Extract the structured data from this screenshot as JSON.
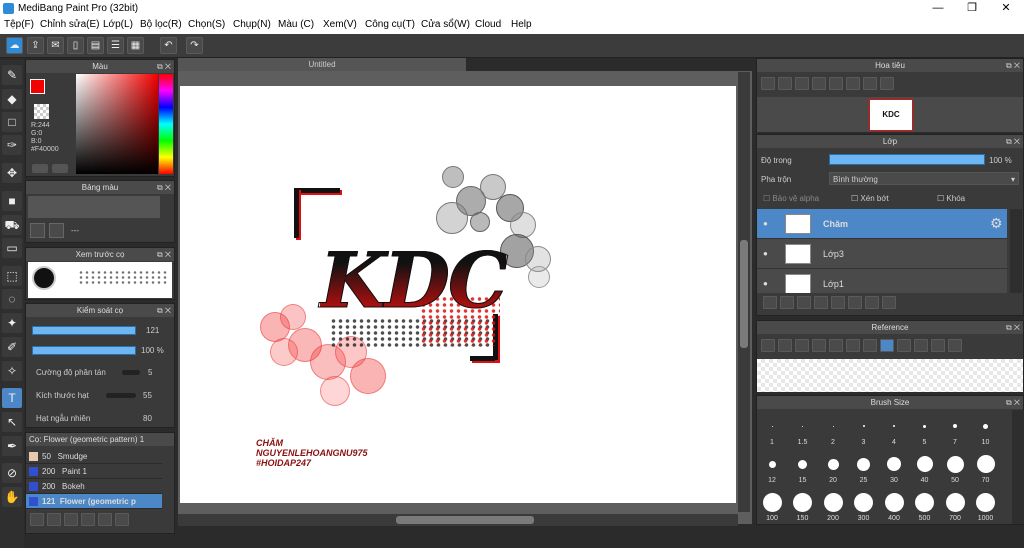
{
  "window": {
    "title": "MediBang Paint Pro (32bit)",
    "minimize": "—",
    "maximize": "❐",
    "close": "✕"
  },
  "menu": [
    "Tệp(F)",
    "Chỉnh sửa(E)",
    "Lớp(L)",
    "Bộ lọc(R)",
    "Chọn(S)",
    "Chụp(N)",
    "Màu (C)",
    "Xem(V)",
    "Công cụ(T)",
    "Cửa sổ(W)",
    "Cloud",
    "Help"
  ],
  "toolbar": {
    "undo": "↶",
    "redo": "↷"
  },
  "color_panel": {
    "title": "Màu",
    "readout": [
      "R:244",
      "G:0",
      "B:0",
      "#F40000"
    ],
    "primary": "#f40000"
  },
  "palette_panel": {
    "title": "Bảng màu",
    "footer": "---"
  },
  "brush_preview_panel": {
    "title": "Xem trước cọ"
  },
  "brush_control_panel": {
    "title": "Kiểm soát cọ",
    "size_value": "121",
    "opacity_value": "100 %",
    "scatter_label": "Cường độ phân tán",
    "scatter_value": "5",
    "particle_label": "Kích thước hạt",
    "particle_value": "55",
    "random_label": "Hạt ngẫu nhiên",
    "random_value": "80"
  },
  "brush_list": {
    "title": "Cọ: Flower (geometric pattern)",
    "count": "1",
    "items": [
      {
        "size": "50",
        "name": "Smudge",
        "color": "#e8c9b0"
      },
      {
        "size": "200",
        "name": "Paint 1",
        "color": "#3050d0"
      },
      {
        "size": "200",
        "name": "Bokeh",
        "color": "#3050d0"
      },
      {
        "size": "121",
        "name": "Flower (geometric p",
        "color": "#3050d0"
      }
    ]
  },
  "document": {
    "tab": "Untitled",
    "art_text": "KDC",
    "signature": [
      "CHĂM",
      "NGUYENLEHOANGNU975",
      "#HOIDAP247"
    ]
  },
  "navigator_panel": {
    "title": "Hoa tiêu",
    "thumb_text": "KDC"
  },
  "layer_panel": {
    "title": "Lớp",
    "opacity_label": "Độ trong",
    "opacity_value": "100 %",
    "blend_label": "Pha trộn",
    "blend_value": "Bình thường",
    "protect_alpha": "Bảo vệ alpha",
    "clipping": "Xén bớt",
    "lock": "Khóa",
    "layers": [
      "Chăm",
      "Lớp3",
      "Lớp1"
    ],
    "opacity_fraction": 1.0
  },
  "reference_panel": {
    "title": "Reference"
  },
  "brush_size_panel": {
    "title": "Brush Size",
    "sizes": [
      "1",
      "1.5",
      "2",
      "3",
      "4",
      "5",
      "7",
      "10",
      "12",
      "15",
      "20",
      "25",
      "30",
      "40",
      "50",
      "70",
      "100",
      "150",
      "200",
      "300",
      "400",
      "500",
      "700",
      "1000"
    ]
  },
  "colors": {
    "accent": "#4c88c7",
    "bar": "#6db6f2",
    "brush_red": "#e01010"
  }
}
